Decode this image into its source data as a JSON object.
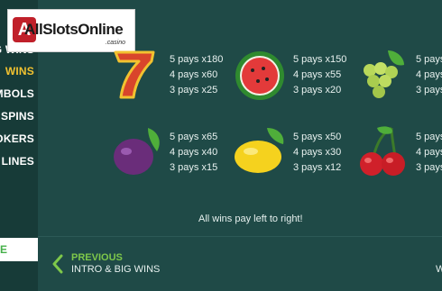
{
  "logo": {
    "text": "AllSlotsOnline",
    "sub": ".casino"
  },
  "sidebar": {
    "items": [
      {
        "label": "G WINS",
        "active": false
      },
      {
        "label": "WINS",
        "active": true
      },
      {
        "label": "SYMBOLS",
        "active": false
      },
      {
        "label": "E SPINS",
        "active": false
      },
      {
        "label": "JOKERS",
        "active": false
      },
      {
        "label": "N LINES",
        "active": false
      }
    ],
    "bottom_label": "E"
  },
  "symbols": [
    {
      "name": "seven",
      "pays": [
        "5 pays x180",
        "4 pays x60",
        "3 pays x25"
      ]
    },
    {
      "name": "watermelon",
      "pays": [
        "5 pays x150",
        "4 pays x55",
        "3 pays x20"
      ]
    },
    {
      "name": "grapes",
      "pays": [
        "5 pays",
        "4 pays",
        "3 pays"
      ]
    },
    {
      "name": "plum",
      "pays": [
        "5 pays x65",
        "4 pays x40",
        "3 pays x15"
      ]
    },
    {
      "name": "lemon",
      "pays": [
        "5 pays x50",
        "4 pays x30",
        "3 pays x12"
      ]
    },
    {
      "name": "cherries",
      "pays": [
        "5 pays",
        "4 pays",
        "3 pays"
      ]
    }
  ],
  "footer_note": "All wins pay left to right!",
  "nav": {
    "previous_label": "PREVIOUS",
    "previous_sub": "INTRO & BIG WINS",
    "next_sub": "W"
  },
  "colors": {
    "background": "#1f4a47",
    "sidebar": "#173b38",
    "active": "#f2c230",
    "nav_accent": "#7ec84a"
  }
}
